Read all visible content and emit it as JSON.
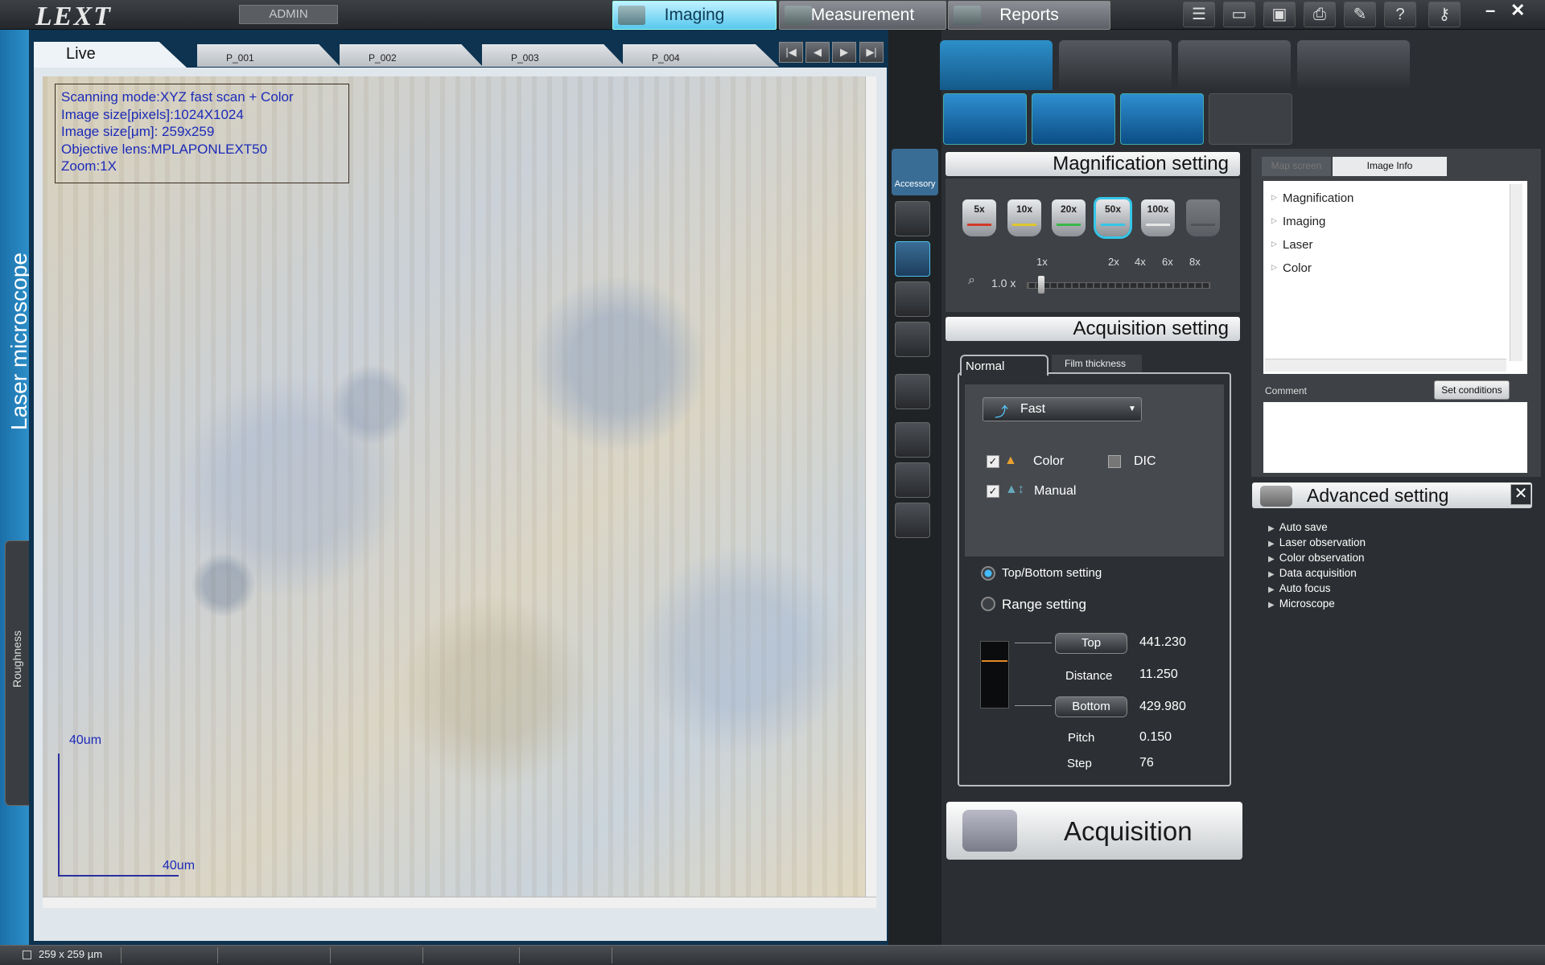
{
  "app": {
    "logo": "LEXT",
    "user": "ADMIN"
  },
  "modes": [
    {
      "label": "Imaging",
      "active": true
    },
    {
      "label": "Measurement",
      "active": false
    },
    {
      "label": "Reports",
      "active": false
    }
  ],
  "toolbar_icons": [
    "list-icon",
    "folder-open-icon",
    "save-icon",
    "print-icon",
    "wrench-icon",
    "help-icon",
    "key-icon"
  ],
  "window_controls": {
    "minimize": "–",
    "close": "✕"
  },
  "left_strip": {
    "title": "Laser microscope",
    "side_tab": "Roughness"
  },
  "image_tabs": {
    "live": "Live",
    "tabs": [
      "P_001",
      "P_002",
      "P_003",
      "P_004"
    ]
  },
  "image_nav": [
    "|◀",
    "◀",
    "▶",
    "▶|"
  ],
  "image_info": {
    "lines": [
      "Scanning mode:XYZ fast scan + Color",
      "Image size[pixels]:1024X1024",
      "Image size[μm]: 259x259",
      "Objective lens:MPLAPONLEXT50",
      "Zoom:1X"
    ]
  },
  "scale": {
    "y_label": "40um",
    "x_label": "40um"
  },
  "tools": {
    "accessory": "Accessory"
  },
  "magnification": {
    "title": "Magnification setting",
    "lenses": [
      {
        "label": "5x",
        "ring": "#d23a2a",
        "selected": false
      },
      {
        "label": "10x",
        "ring": "#e2c62a",
        "selected": false
      },
      {
        "label": "20x",
        "ring": "#3ab84a",
        "selected": false
      },
      {
        "label": "50x",
        "ring": "#35c6e8",
        "selected": true
      },
      {
        "label": "100x",
        "ring": "#e6e6e6",
        "selected": false
      },
      {
        "label": "",
        "ring": "#777777",
        "selected": false
      }
    ],
    "zoom_marks": [
      "1x",
      "2x",
      "4x",
      "6x",
      "8x"
    ],
    "zoom_value": "1.0 x"
  },
  "acquisition": {
    "title": "Acquisition setting",
    "tabs": {
      "normal": "Normal",
      "film": "Film thickness"
    },
    "mode": "Fast",
    "color": {
      "label": "Color",
      "checked": true
    },
    "dic": {
      "label": "DIC",
      "checked": false
    },
    "manual": {
      "label": "Manual",
      "checked": true
    },
    "top_bottom": "Top/Bottom setting",
    "range": "Range setting",
    "top_btn": "Top",
    "top_val": "441.230",
    "distance_lbl": "Distance",
    "distance_val": "11.250",
    "bottom_btn": "Bottom",
    "bottom_val": "429.980",
    "pitch_lbl": "Pitch",
    "pitch_val": "0.150",
    "step_lbl": "Step",
    "step_val": "76",
    "button": "Acquisition"
  },
  "info_panel": {
    "tabs": [
      "Map screen",
      "Image Info"
    ],
    "tree": [
      "Magnification",
      "Imaging",
      "Laser",
      "Color"
    ],
    "comment_label": "Comment",
    "set_conditions": "Set conditions"
  },
  "advanced": {
    "title": "Advanced setting",
    "items": [
      "Auto save",
      "Laser observation",
      "Color observation",
      "Data acquisition",
      "Auto focus",
      "Microscope"
    ]
  },
  "status": {
    "size": "259 x 259 µm"
  }
}
